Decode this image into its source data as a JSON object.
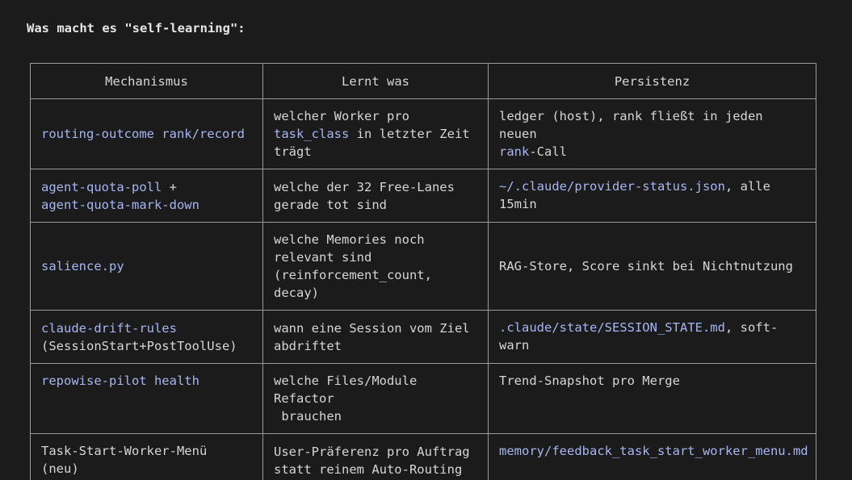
{
  "heading": "Was macht es \"self-learning\":",
  "table": {
    "headers": [
      "Mechanismus",
      "Lernt was",
      "Persistenz"
    ],
    "rows": [
      {
        "mechanism": {
          "code": "routing-outcome rank/record"
        },
        "learns": {
          "pre": "welcher Worker pro\n",
          "code": "task_class",
          "post": " in letzter Zeit\nträgt"
        },
        "persistence": {
          "pre": "ledger (host), rank fließt in jeden neuen\n",
          "code": "rank",
          "post": "-Call"
        }
      },
      {
        "mechanism": {
          "code1": "agent-quota-poll",
          "mid": " +\n",
          "code2": "agent-quota-mark-down"
        },
        "learns": {
          "text": "welche der 32 Free-Lanes\ngerade tot sind"
        },
        "persistence": {
          "code": "~/.claude/provider-status.json",
          "post": ", alle 15min"
        }
      },
      {
        "mechanism": {
          "code": "salience.py"
        },
        "learns": {
          "text": "welche Memories noch\nrelevant sind\n(reinforcement_count, decay)"
        },
        "persistence": {
          "text": "RAG-Store, Score sinkt bei Nichtnutzung"
        }
      },
      {
        "mechanism": {
          "code": "claude-drift-rules",
          "post": "\n(SessionStart+PostToolUse)"
        },
        "learns": {
          "text": "wann eine Session vom Ziel\nabdriftet"
        },
        "persistence": {
          "code": ".claude/state/SESSION_STATE.md",
          "post": ", soft-warn"
        }
      },
      {
        "mechanism": {
          "code": "repowise-pilot health"
        },
        "learns": {
          "text": "welche Files/Module Refactor\n brauchen"
        },
        "persistence": {
          "text": "Trend-Snapshot pro Merge"
        }
      },
      {
        "mechanism": {
          "text": "Task-Start-Worker-Menü (neu)"
        },
        "learns": {
          "text": "User-Präferenz pro Auftrag\nstatt reinem Auto-Routing"
        },
        "persistence": {
          "code": "memory/feedback_task_start_worker_menu.md"
        }
      }
    ]
  }
}
